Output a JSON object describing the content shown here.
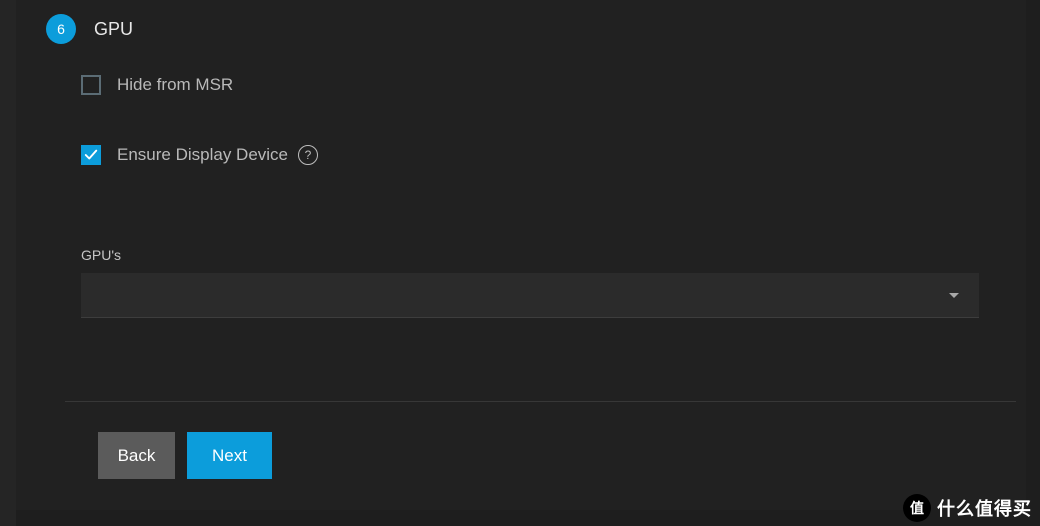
{
  "step": {
    "number": "6",
    "title": "GPU"
  },
  "options": {
    "hide_msr": {
      "label": "Hide from MSR",
      "checked": false
    },
    "ensure_display": {
      "label": "Ensure Display Device",
      "checked": true
    }
  },
  "gpus": {
    "label": "GPU's",
    "selected": ""
  },
  "buttons": {
    "back": "Back",
    "next": "Next"
  },
  "watermark": {
    "badge": "值",
    "text": "什么值得买"
  }
}
